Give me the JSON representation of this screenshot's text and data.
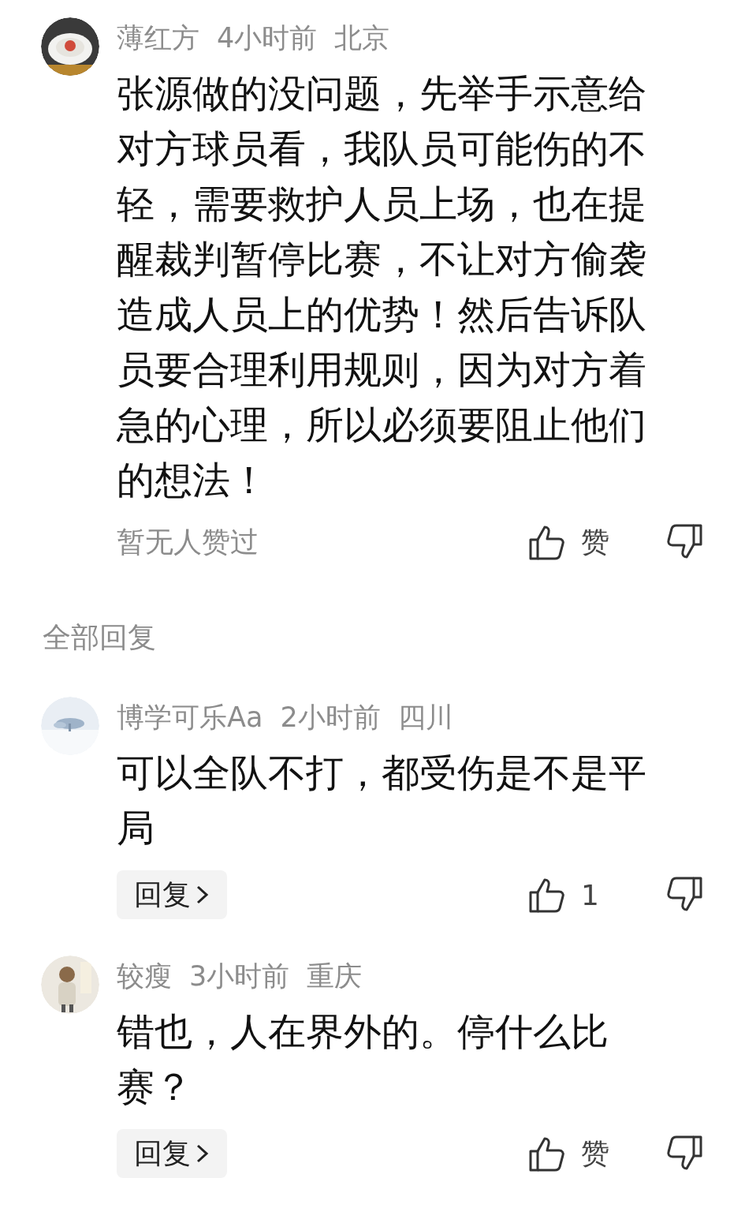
{
  "main_comment": {
    "author": "薄红方",
    "time": "4小时前",
    "location": "北京",
    "text": "张源做的没问题，先举手示意给对方球员看，我队员可能伤的不轻，需要救护人员上场，也在提醒裁判暂停比赛，不让对方偷袭造成人员上的优势！然后告诉队员要合理利用规则，因为对方着急的心理，所以必须要阻止他们的想法！",
    "likes_summary": "暂无人赞过",
    "like_label": "赞"
  },
  "replies_header": "全部回复",
  "replies": [
    {
      "author": "博学可乐Aa",
      "time": "2小时前",
      "location": "四川",
      "text": "可以全队不打，都受伤是不是平局",
      "reply_button": "回复",
      "like_label": "1"
    },
    {
      "author": "较瘦",
      "time": "3小时前",
      "location": "重庆",
      "text": "错也，人在界外的。停什么比赛？",
      "reply_button": "回复",
      "like_label": "赞"
    }
  ]
}
